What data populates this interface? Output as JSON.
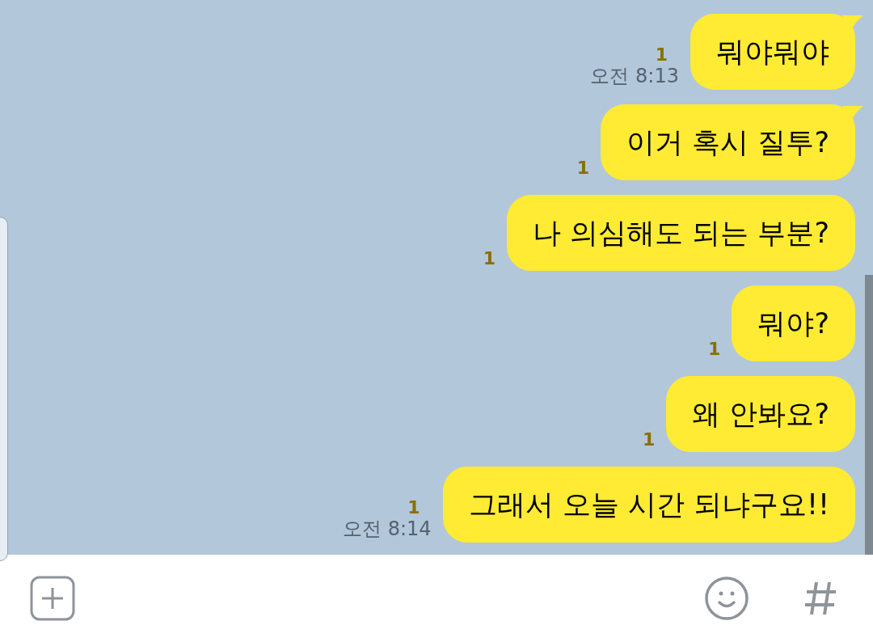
{
  "messages": [
    {
      "text": "뭐야뭐야",
      "unread": "1",
      "time": "오전 8:13",
      "tail": true
    },
    {
      "text": "이거 혹시 질투?",
      "unread": "1",
      "tail": true
    },
    {
      "text": "나 의심해도 되는 부분?",
      "unread": "1",
      "tail": false
    },
    {
      "text": "뭐야?",
      "unread": "1",
      "tail": false
    },
    {
      "text": "왜 안봐요?",
      "unread": "1",
      "tail": false
    },
    {
      "text": "그래서 오늘 시간 되냐구요!!",
      "unread": "1",
      "time": "오전 8:14",
      "tail": false
    }
  ]
}
